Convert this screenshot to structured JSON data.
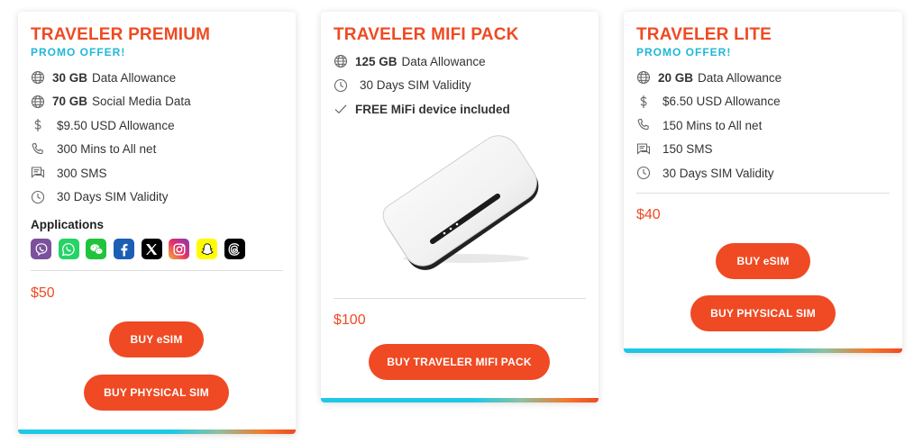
{
  "colors": {
    "accent": "#ef4a23",
    "promo": "#1fb7d9"
  },
  "premium": {
    "title": "TRAVELER PREMIUM",
    "promo": "PROMO OFFER!",
    "features": [
      {
        "icon": "globe-icon",
        "bold": "30 GB",
        "text": "Data Allowance"
      },
      {
        "icon": "globe-icon",
        "bold": "70 GB",
        "text": "Social Media Data"
      },
      {
        "icon": "dollar-icon",
        "bold": "",
        "text": "$9.50 USD Allowance"
      },
      {
        "icon": "phone-icon",
        "bold": "",
        "text": "300 Mins to All net"
      },
      {
        "icon": "sms-icon",
        "bold": "",
        "text": "300 SMS"
      },
      {
        "icon": "clock-icon",
        "bold": "",
        "text": "30 Days SIM Validity"
      }
    ],
    "apps_title": "Applications",
    "apps": [
      "viber-icon",
      "whatsapp-icon",
      "wechat-icon",
      "facebook-icon",
      "x-icon",
      "instagram-icon",
      "snapchat-icon",
      "threads-icon"
    ],
    "price": "$50",
    "buy_esim": "BUY eSIM",
    "buy_physical": "BUY PHYSICAL SIM"
  },
  "mifi": {
    "title": "TRAVELER MIFI PACK",
    "features": [
      {
        "icon": "globe-icon",
        "bold": "125 GB",
        "text": "Data Allowance"
      },
      {
        "icon": "clock-icon",
        "bold": "",
        "text": "30 Days SIM Validity"
      },
      {
        "icon": "check-icon",
        "bold": "FREE MiFi device included",
        "text": ""
      }
    ],
    "image": "mifi-device-image",
    "price": "$100",
    "buy": "BUY TRAVELER MIFI PACK"
  },
  "lite": {
    "title": "TRAVELER LITE",
    "promo": "PROMO OFFER!",
    "features": [
      {
        "icon": "globe-icon",
        "bold": "20 GB",
        "text": "Data Allowance"
      },
      {
        "icon": "dollar-icon",
        "bold": "",
        "text": "$6.50 USD Allowance"
      },
      {
        "icon": "phone-icon",
        "bold": "",
        "text": "150 Mins to All net"
      },
      {
        "icon": "sms-icon",
        "bold": "",
        "text": "150 SMS"
      },
      {
        "icon": "clock-icon",
        "bold": "",
        "text": "30 Days SIM Validity"
      }
    ],
    "price": "$40",
    "buy_esim": "BUY eSIM",
    "buy_physical": "BUY PHYSICAL SIM"
  }
}
